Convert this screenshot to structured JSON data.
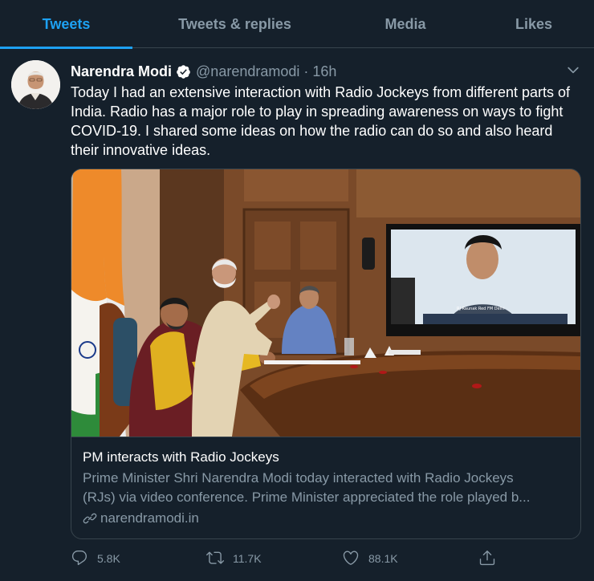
{
  "tabs": [
    {
      "label": "Tweets",
      "active": true
    },
    {
      "label": "Tweets & replies",
      "active": false
    },
    {
      "label": "Media",
      "active": false
    },
    {
      "label": "Likes",
      "active": false
    }
  ],
  "tweet": {
    "author_name": "Narendra Modi",
    "handle": "@narendramodi",
    "separator": "·",
    "time": "16h",
    "text": "Today I had an extensive interaction with Radio Jockeys from different parts of India. Radio has a major role to play in spreading awareness on ways to fight COVID-19. I shared some ideas on how the radio can do so and also heard their innovative ideas.",
    "card": {
      "title": "PM interacts with Radio Jockeys",
      "description_line1": "Prime Minister Shri Narendra Modi today interacted with Radio Jockeys",
      "description_line2": "(RJs) via video conference. Prime Minister appreciated the role played b...",
      "domain": "narendramodi.in",
      "screen_caption": "RJ Raunak Red FM Delhi"
    },
    "actions": {
      "reply_count": "5.8K",
      "retweet_count": "11.7K",
      "like_count": "88.1K"
    }
  },
  "icons": {
    "verified": "verified-badge-icon",
    "chevron": "chevron-down-icon",
    "link": "link-icon",
    "reply": "reply-icon",
    "retweet": "retweet-icon",
    "like": "heart-icon",
    "share": "share-icon"
  },
  "colors": {
    "background": "#15202b",
    "accent": "#1da1f2",
    "secondary_text": "#8899a6",
    "border": "#38444d"
  }
}
